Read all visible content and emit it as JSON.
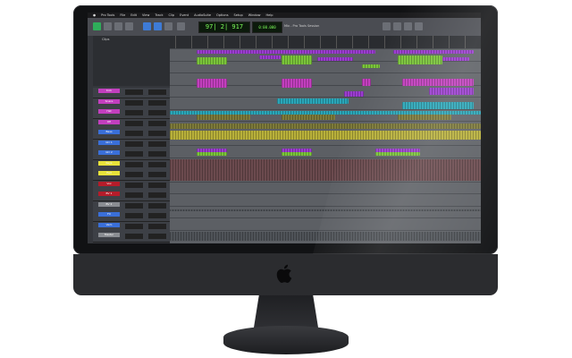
{
  "menubar": {
    "items": [
      "Pro Tools",
      "File",
      "Edit",
      "View",
      "Track",
      "Clip",
      "Event",
      "AudioSuite",
      "Options",
      "Setup",
      "Window",
      "Help"
    ]
  },
  "window": {
    "title": "Mix - Pro Tools Session"
  },
  "transport": {
    "main_counter": "97| 2| 917",
    "sub_counter": "0:00.000"
  },
  "clips_panel": {
    "title": "Clips"
  },
  "tracks": [
    {
      "name": "Kick",
      "color": "#c23fbe"
    },
    {
      "name": "Snare",
      "color": "#c23fbe"
    },
    {
      "name": "Hat",
      "color": "#c23fbe"
    },
    {
      "name": "OH",
      "color": "#c23fbe"
    },
    {
      "name": "Bass",
      "color": "#3a6fd8"
    },
    {
      "name": "Gtr 1",
      "color": "#3a6fd8"
    },
    {
      "name": "Gtr 2",
      "color": "#3a6fd8"
    },
    {
      "name": "Keys",
      "color": "#e8e23a"
    },
    {
      "name": "Pad",
      "color": "#e8e23a"
    },
    {
      "name": "Vox",
      "color": "#b51c2a"
    },
    {
      "name": "BV 1",
      "color": "#b51c2a"
    },
    {
      "name": "BV 2",
      "color": "#8a8d92"
    },
    {
      "name": "FX",
      "color": "#3a6fd8"
    },
    {
      "name": "Verb",
      "color": "#3a6fd8"
    },
    {
      "name": "Master",
      "color": "#8a8d92"
    }
  ],
  "colors": {
    "purple": "#9b3cd0",
    "magenta": "#c23fbe",
    "green": "#7ac43a",
    "teal": "#2aa6b8",
    "olive": "#7d7a3a",
    "yellow": "#b8b03a",
    "screen_bg": "#3b3d42",
    "counter_green": "#7dff5a"
  }
}
